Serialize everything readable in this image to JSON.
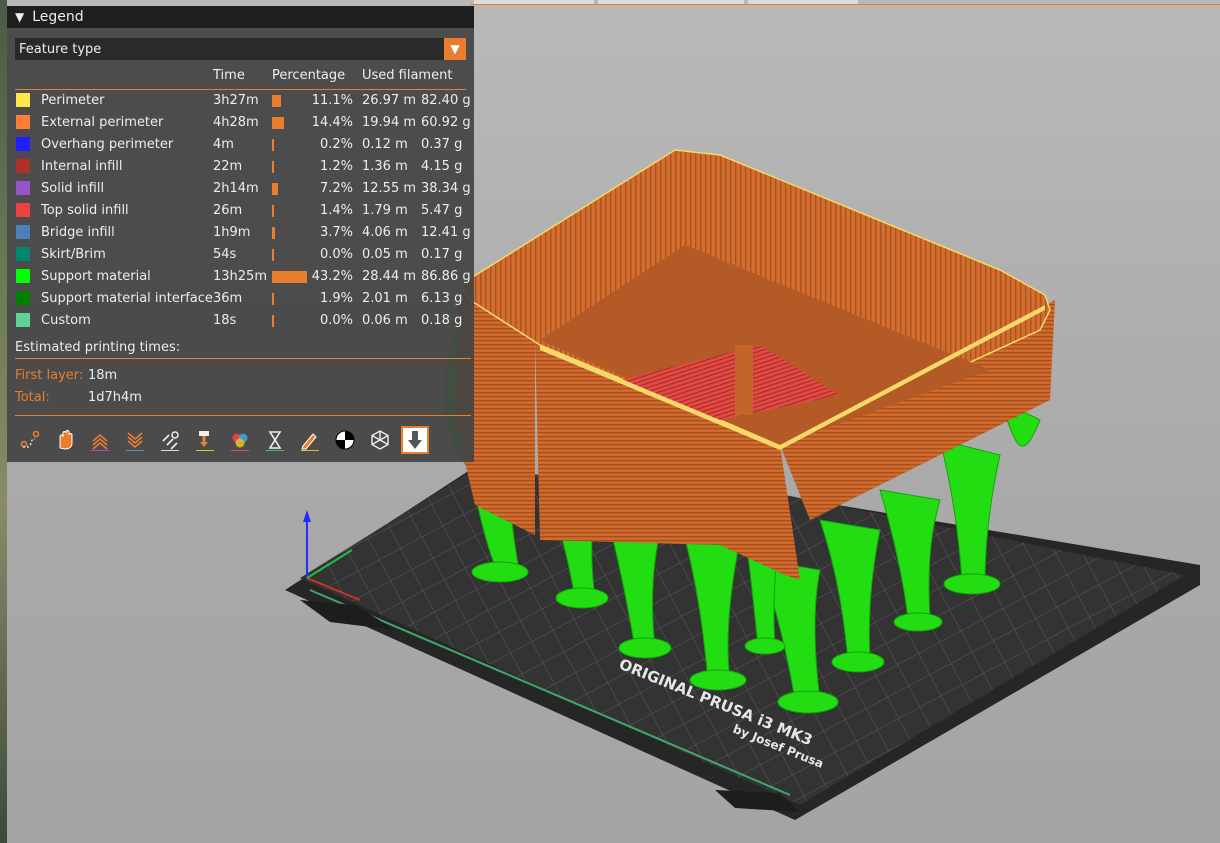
{
  "legend": {
    "title": "Legend",
    "dropdown": {
      "selected": "Feature type"
    },
    "headers": {
      "time": "Time",
      "percentage": "Percentage",
      "used_filament": "Used filament"
    },
    "rows": [
      {
        "name": "Perimeter",
        "color": "#ffe64d",
        "time": "3h27m",
        "percent": "11.1%",
        "value": 11.1,
        "length": "26.97 m",
        "weight": "82.40 g"
      },
      {
        "name": "External perimeter",
        "color": "#ff7d38",
        "time": "4h28m",
        "percent": "14.4%",
        "value": 14.4,
        "length": "19.94 m",
        "weight": "60.92 g"
      },
      {
        "name": "Overhang perimeter",
        "color": "#1f1fff",
        "time": "4m",
        "percent": "0.2%",
        "value": 0.2,
        "length": "0.12 m",
        "weight": "0.37 g"
      },
      {
        "name": "Internal infill",
        "color": "#b03029",
        "time": "22m",
        "percent": "1.2%",
        "value": 1.2,
        "length": "1.36 m",
        "weight": "4.15 g"
      },
      {
        "name": "Solid infill",
        "color": "#9654cc",
        "time": "2h14m",
        "percent": "7.2%",
        "value": 7.2,
        "length": "12.55 m",
        "weight": "38.34 g"
      },
      {
        "name": "Top solid infill",
        "color": "#f04040",
        "time": "26m",
        "percent": "1.4%",
        "value": 1.4,
        "length": "1.79 m",
        "weight": "5.47 g"
      },
      {
        "name": "Bridge infill",
        "color": "#4d80ba",
        "time": "1h9m",
        "percent": "3.7%",
        "value": 3.7,
        "length": "4.06 m",
        "weight": "12.41 g"
      },
      {
        "name": "Skirt/Brim",
        "color": "#00876e",
        "time": "54s",
        "percent": "0.0%",
        "value": 0.0,
        "length": "0.05 m",
        "weight": "0.17 g"
      },
      {
        "name": "Support material",
        "color": "#00ff00",
        "time": "13h25m",
        "percent": "43.2%",
        "value": 43.2,
        "length": "28.44 m",
        "weight": "86.86 g"
      },
      {
        "name": "Support material interface",
        "color": "#008000",
        "time": "36m",
        "percent": "1.9%",
        "value": 1.9,
        "length": "2.01 m",
        "weight": "6.13 g"
      },
      {
        "name": "Custom",
        "color": "#5ed194",
        "time": "18s",
        "percent": "0.0%",
        "value": 0.0,
        "length": "0.06 m",
        "weight": "0.18 g"
      }
    ],
    "estimated_heading": "Estimated printing times:",
    "first_layer_label": "First layer:",
    "first_layer_value": "18m",
    "total_label": "Total:",
    "total_value": "1d7h4m",
    "toolbar": [
      {
        "icon": "travel-icon",
        "active": false
      },
      {
        "icon": "wipe-icon",
        "active": false
      },
      {
        "icon": "retractions-icon",
        "active": false
      },
      {
        "icon": "deretractions-icon",
        "active": false
      },
      {
        "icon": "seams-icon",
        "active": false
      },
      {
        "icon": "tool-changes-icon",
        "active": false
      },
      {
        "icon": "color-changes-icon",
        "active": false
      },
      {
        "icon": "pause-icon",
        "active": false
      },
      {
        "icon": "custom-gcode-icon",
        "active": false
      },
      {
        "icon": "center-of-gravity-icon",
        "active": false
      },
      {
        "icon": "shells-icon",
        "active": false
      },
      {
        "icon": "tool-marker-icon",
        "active": true
      }
    ]
  },
  "bed": {
    "brand_line1": "ORIGINAL PRUSA i3 MK3",
    "brand_line2": "by Josef Prusa"
  },
  "colors": {
    "accent": "#e97e2f",
    "model": "#d06a2c",
    "support": "#22dd11",
    "bed": "#2e2e2e"
  }
}
